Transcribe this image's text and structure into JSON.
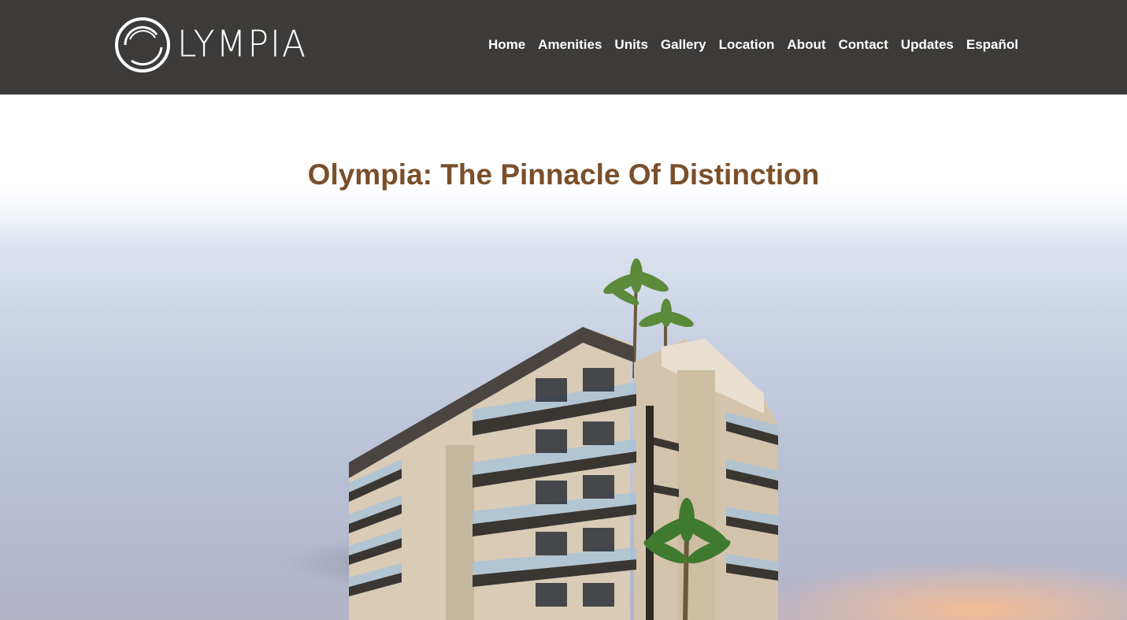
{
  "header": {
    "logo_text": "LYMPIA",
    "logo_alt": "OLYMPIA",
    "nav": [
      {
        "label": "Home"
      },
      {
        "label": "Amenities"
      },
      {
        "label": "Units"
      },
      {
        "label": "Gallery"
      },
      {
        "label": "Location"
      },
      {
        "label": "About"
      },
      {
        "label": "Contact"
      },
      {
        "label": "Updates"
      },
      {
        "label": "Español"
      }
    ]
  },
  "hero": {
    "title": "Olympia: The Pinnacle Of Distinction",
    "image_description": ""
  },
  "colors": {
    "header_bg": "#3c3b39",
    "title_color": "#7a4f2a",
    "nav_text": "#ffffff"
  }
}
